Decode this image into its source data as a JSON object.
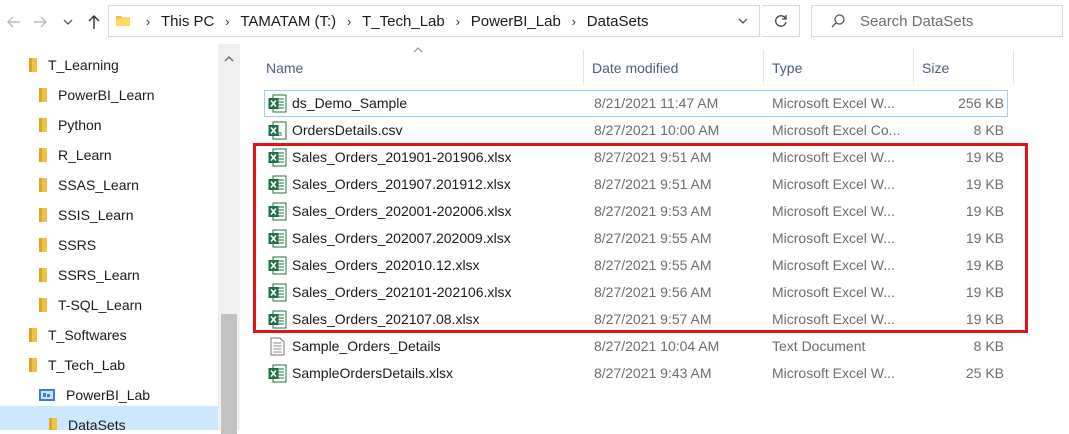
{
  "toolbar": {
    "back_icon": "arrow-left-icon",
    "forward_icon": "arrow-right-icon",
    "recent_icon": "chevron-down-icon",
    "up_icon": "arrow-up-icon"
  },
  "address": {
    "crumbs": [
      "This PC",
      "TAMATAM (T:)",
      "T_Tech_Lab",
      "PowerBI_Lab",
      "DataSets"
    ]
  },
  "search": {
    "placeholder": "Search DataSets"
  },
  "nav_tree": [
    {
      "label": "T_Learning",
      "icon": "folder-icon",
      "selected": false
    },
    {
      "label": "PowerBI_Learn",
      "icon": "folder-icon",
      "selected": false
    },
    {
      "label": "Python",
      "icon": "folder-icon",
      "selected": false
    },
    {
      "label": "R_Learn",
      "icon": "folder-icon",
      "selected": false
    },
    {
      "label": "SSAS_Learn",
      "icon": "folder-icon",
      "selected": false
    },
    {
      "label": "SSIS_Learn",
      "icon": "folder-icon",
      "selected": false
    },
    {
      "label": "SSRS",
      "icon": "folder-icon",
      "selected": false
    },
    {
      "label": "SSRS_Learn",
      "icon": "folder-icon",
      "selected": false
    },
    {
      "label": "T-SQL_Learn",
      "icon": "folder-icon",
      "selected": false
    },
    {
      "label": "T_Softwares",
      "icon": "folder-icon",
      "selected": false
    },
    {
      "label": "T_Tech_Lab",
      "icon": "folder-icon",
      "selected": false
    },
    {
      "label": "PowerBI_Lab",
      "icon": "pbi-folder-icon",
      "selected": false
    },
    {
      "label": "DataSets",
      "icon": "folder-icon",
      "selected": true
    }
  ],
  "columns": {
    "name": "Name",
    "date": "Date modified",
    "type": "Type",
    "size": "Size"
  },
  "files": [
    {
      "name": "ds_Demo_Sample",
      "date": "8/21/2021 11:47 AM",
      "type": "Microsoft Excel W...",
      "size": "256 KB",
      "icon": "excel-icon"
    },
    {
      "name": "OrdersDetails.csv",
      "date": "8/27/2021 10:00 AM",
      "type": "Microsoft Excel Co...",
      "size": "8 KB",
      "icon": "excel-csv-icon"
    },
    {
      "name": "Sales_Orders_201901-201906.xlsx",
      "date": "8/27/2021 9:51 AM",
      "type": "Microsoft Excel W...",
      "size": "19 KB",
      "icon": "excel-icon"
    },
    {
      "name": "Sales_Orders_201907.201912.xlsx",
      "date": "8/27/2021 9:51 AM",
      "type": "Microsoft Excel W...",
      "size": "19 KB",
      "icon": "excel-icon"
    },
    {
      "name": "Sales_Orders_202001-202006.xlsx",
      "date": "8/27/2021 9:53 AM",
      "type": "Microsoft Excel W...",
      "size": "19 KB",
      "icon": "excel-icon"
    },
    {
      "name": "Sales_Orders_202007.202009.xlsx",
      "date": "8/27/2021 9:55 AM",
      "type": "Microsoft Excel W...",
      "size": "19 KB",
      "icon": "excel-icon"
    },
    {
      "name": "Sales_Orders_202010.12.xlsx",
      "date": "8/27/2021 9:55 AM",
      "type": "Microsoft Excel W...",
      "size": "19 KB",
      "icon": "excel-icon"
    },
    {
      "name": "Sales_Orders_202101-202106.xlsx",
      "date": "8/27/2021 9:56 AM",
      "type": "Microsoft Excel W...",
      "size": "19 KB",
      "icon": "excel-icon"
    },
    {
      "name": "Sales_Orders_202107.08.xlsx",
      "date": "8/27/2021 9:57 AM",
      "type": "Microsoft Excel W...",
      "size": "19 KB",
      "icon": "excel-icon"
    },
    {
      "name": "Sample_Orders_Details",
      "date": "8/27/2021 10:04 AM",
      "type": "Text Document",
      "size": "8 KB",
      "icon": "text-file-icon"
    },
    {
      "name": "SampleOrdersDetails.xlsx",
      "date": "8/27/2021 9:43 AM",
      "type": "Microsoft Excel W...",
      "size": "25 KB",
      "icon": "excel-icon"
    }
  ],
  "colors": {
    "highlight_box": "#e0121a",
    "selection": "#cce8ff",
    "focus_outline": "#99d1ff",
    "excel_green": "#1e7145",
    "folder_yellow": "#f0c243"
  }
}
